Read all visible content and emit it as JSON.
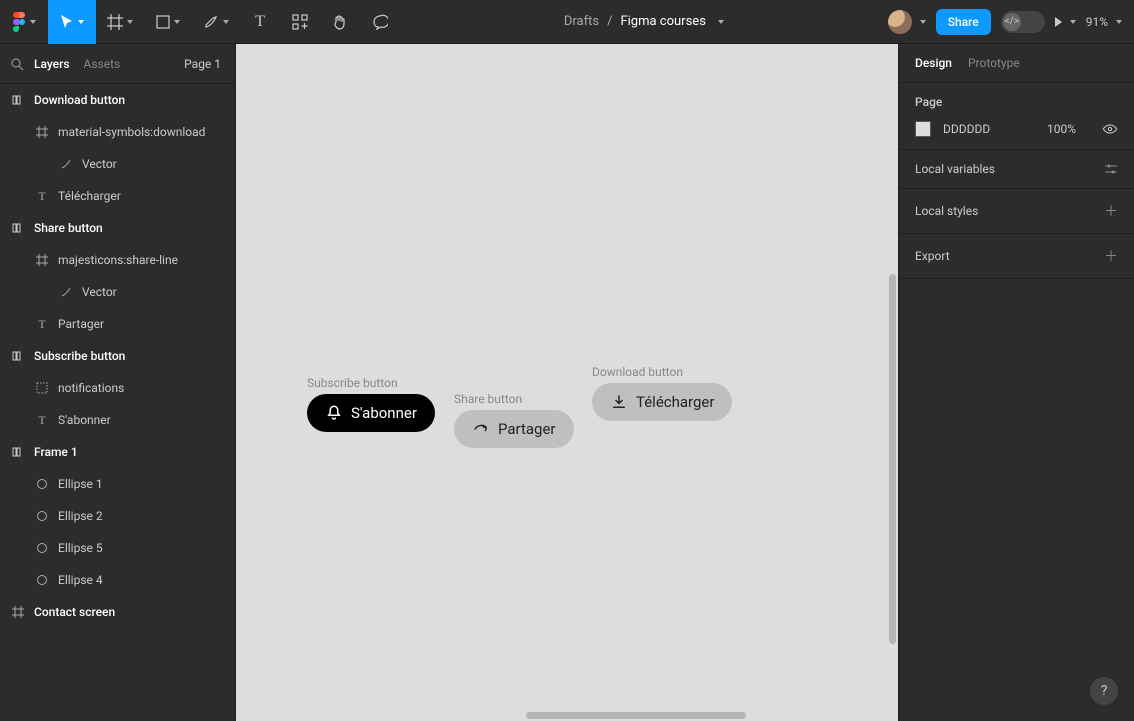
{
  "toolbar": {
    "breadcrumb_root": "Drafts",
    "breadcrumb_file": "Figma courses",
    "share_label": "Share",
    "zoom_label": "91%"
  },
  "left_panel": {
    "tabs": {
      "layers": "Layers",
      "assets": "Assets"
    },
    "page_selector": "Page 1",
    "layers": [
      {
        "name": "Download button",
        "depth": 0,
        "icon": "auto-layout"
      },
      {
        "name": "material-symbols:download",
        "depth": 1,
        "icon": "frame"
      },
      {
        "name": "Vector",
        "depth": 2,
        "icon": "vector"
      },
      {
        "name": "Télécharger",
        "depth": 1,
        "icon": "text"
      },
      {
        "name": "Share button",
        "depth": 0,
        "icon": "auto-layout"
      },
      {
        "name": "majesticons:share-line",
        "depth": 1,
        "icon": "frame"
      },
      {
        "name": "Vector",
        "depth": 2,
        "icon": "vector"
      },
      {
        "name": "Partager",
        "depth": 1,
        "icon": "text"
      },
      {
        "name": "Subscribe button",
        "depth": 0,
        "icon": "auto-layout"
      },
      {
        "name": "notifications",
        "depth": 1,
        "icon": "group"
      },
      {
        "name": "S'abonner",
        "depth": 1,
        "icon": "text"
      },
      {
        "name": "Frame 1",
        "depth": 0,
        "icon": "auto-layout"
      },
      {
        "name": "Ellipse 1",
        "depth": 1,
        "icon": "ellipse"
      },
      {
        "name": "Ellipse 2",
        "depth": 1,
        "icon": "ellipse"
      },
      {
        "name": "Ellipse 5",
        "depth": 1,
        "icon": "ellipse"
      },
      {
        "name": "Ellipse 4",
        "depth": 1,
        "icon": "ellipse"
      },
      {
        "name": "Contact screen",
        "depth": 0,
        "icon": "frame"
      }
    ]
  },
  "canvas": {
    "background": "DDDDDD",
    "components": [
      {
        "label": "Subscribe button",
        "text": "S'abonner",
        "icon": "bell",
        "style": "dark"
      },
      {
        "label": "Share button",
        "text": "Partager",
        "icon": "share",
        "style": "grey"
      },
      {
        "label": "Download button",
        "text": "Télécharger",
        "icon": "download",
        "style": "grey"
      }
    ]
  },
  "right_panel": {
    "tabs": {
      "design": "Design",
      "prototype": "Prototype"
    },
    "page_section_title": "Page",
    "page_color": "DDDDDD",
    "page_opacity": "100%",
    "sections": {
      "local_variables": "Local variables",
      "local_styles": "Local styles",
      "export": "Export"
    }
  },
  "help_label": "?"
}
